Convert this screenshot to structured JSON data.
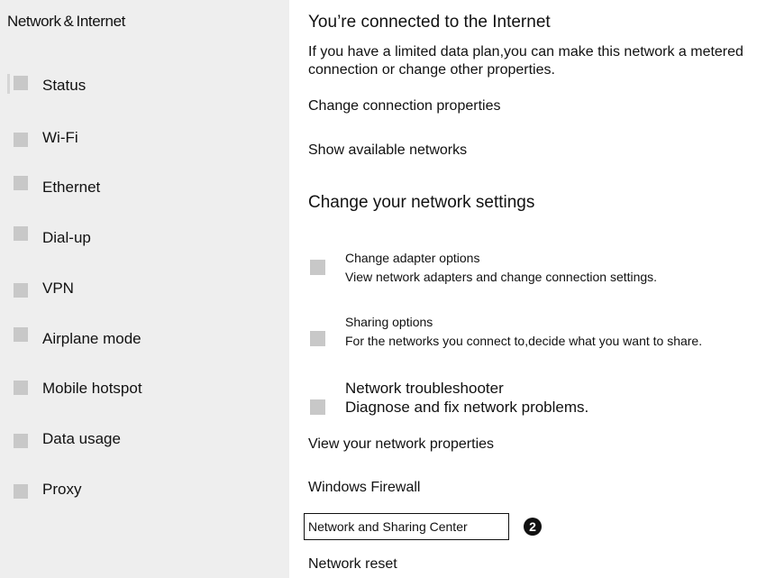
{
  "sidebar": {
    "title": "Network & Internet",
    "items": [
      {
        "label": "Status"
      },
      {
        "label": "Wi-Fi"
      },
      {
        "label": "Ethernet"
      },
      {
        "label": "Dial-up"
      },
      {
        "label": "VPN"
      },
      {
        "label": "Airplane mode"
      },
      {
        "label": "Mobile hotspot"
      },
      {
        "label": "Data usage"
      },
      {
        "label": "Proxy"
      }
    ]
  },
  "main": {
    "status_heading": "You’re connected to the Internet",
    "status_text": "If you have a limited data plan,you can make this network a metered connection or change other properties.",
    "change_connection_link": "Change connection properties",
    "show_networks_link": "Show available networks",
    "settings_heading": "Change your network settings",
    "settings": [
      {
        "title": "Change adapter options",
        "desc": "View network adapters and change connection settings."
      },
      {
        "title": "Sharing options",
        "desc": "For the networks you connect to,decide what you want to share."
      },
      {
        "title": "Network troubleshooter",
        "desc": "Diagnose and fix network problems."
      }
    ],
    "view_properties_link": "View your network properties",
    "firewall_link": "Windows Firewall",
    "sharing_center_link": "Network and Sharing Center",
    "callout_number": "2",
    "reset_link": "Network reset"
  }
}
